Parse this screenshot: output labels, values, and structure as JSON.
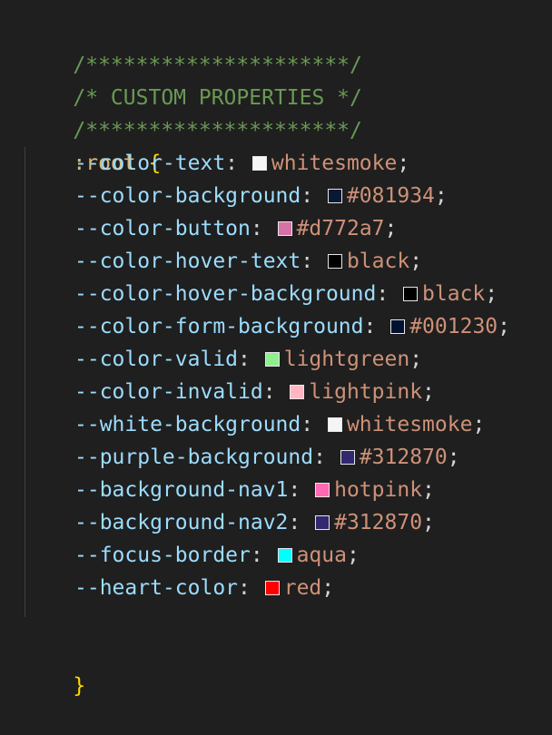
{
  "editor": {
    "comment_top": "/*********************/",
    "comment_title": "/* CUSTOM PROPERTIES */",
    "comment_bottom": "/*********************/",
    "selector": ":root",
    "open_brace": "{",
    "close_brace": "}",
    "declarations": [
      {
        "property": "--color-text",
        "value": "whitesmoke",
        "swatch": "#f5f5f5"
      },
      {
        "property": "--color-background",
        "value": "#081934",
        "swatch": "#081934"
      },
      {
        "property": "--color-button",
        "value": "#d772a7",
        "swatch": "#d772a7"
      },
      {
        "property": "--color-hover-text",
        "value": "black",
        "swatch": "#000000"
      },
      {
        "property": "--color-hover-background",
        "value": "black",
        "swatch": "#000000"
      },
      {
        "property": "--color-form-background",
        "value": "#001230",
        "swatch": "#001230"
      },
      {
        "property": "--color-valid",
        "value": "lightgreen",
        "swatch": "#90ee90"
      },
      {
        "property": "--color-invalid",
        "value": "lightpink",
        "swatch": "#ffb6c1"
      },
      {
        "property": "--white-background",
        "value": "whitesmoke",
        "swatch": "#f5f5f5"
      },
      {
        "property": "--purple-background",
        "value": "#312870",
        "swatch": "#312870"
      },
      {
        "property": "--background-nav1",
        "value": "hotpink",
        "swatch": "#ff69b4"
      },
      {
        "property": "--background-nav2",
        "value": "#312870",
        "swatch": "#312870"
      },
      {
        "property": "--focus-border",
        "value": "aqua",
        "swatch": "#00ffff"
      },
      {
        "property": "--heart-color",
        "value": "red",
        "swatch": "#ff0000"
      }
    ]
  }
}
